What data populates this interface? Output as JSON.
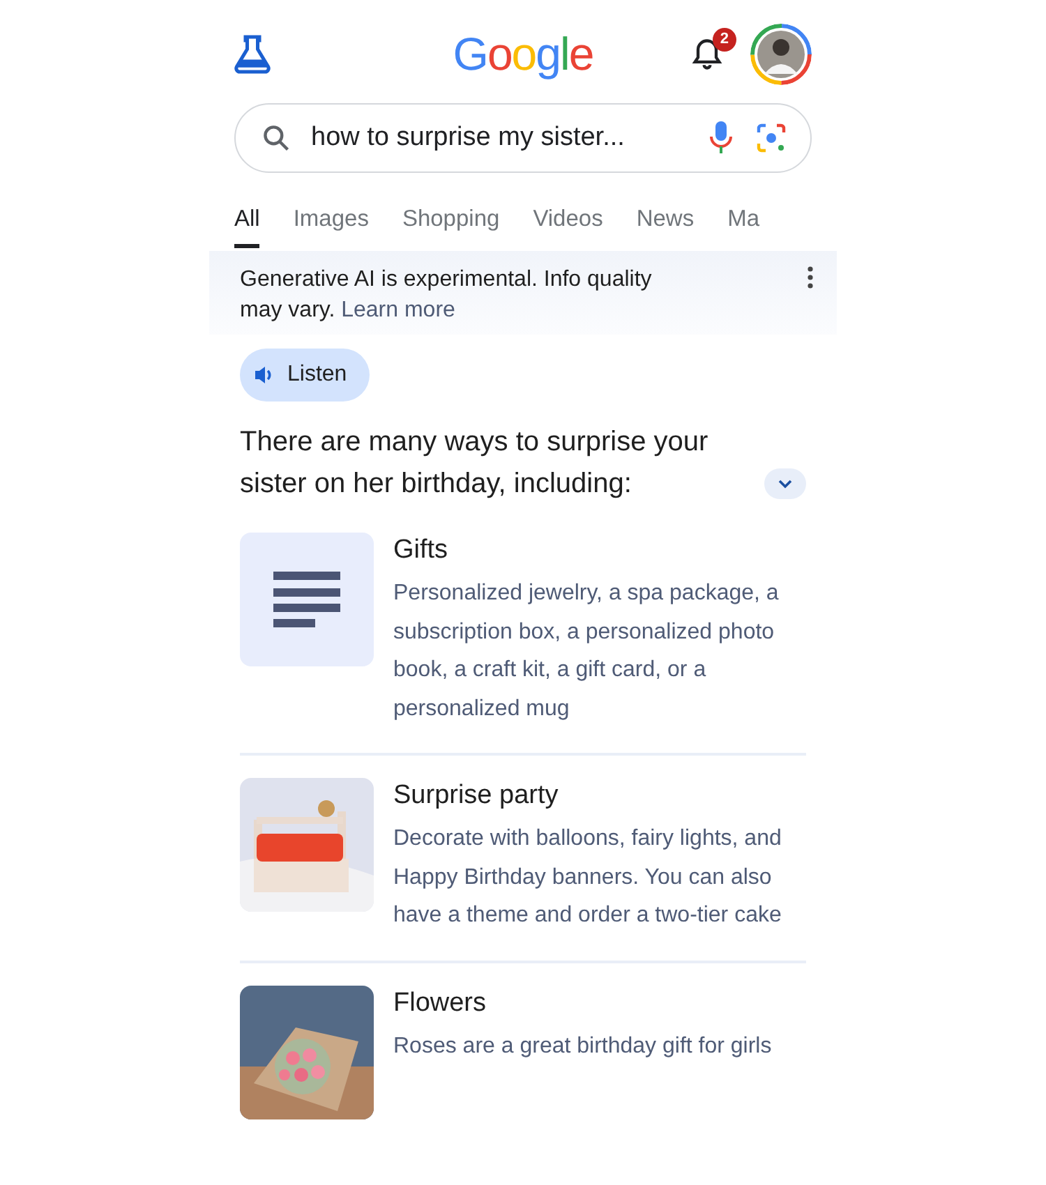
{
  "header": {
    "logo": "Google",
    "notifications": {
      "count": "2"
    }
  },
  "search": {
    "value": "how to surprise my sister..."
  },
  "tabs": [
    {
      "label": "All",
      "selected": true
    },
    {
      "label": "Images",
      "selected": false
    },
    {
      "label": "Shopping",
      "selected": false
    },
    {
      "label": "Videos",
      "selected": false
    },
    {
      "label": "News",
      "selected": false
    },
    {
      "label": "Ma",
      "selected": false
    }
  ],
  "notice": {
    "text": "Generative AI is experimental. Info quality may vary.",
    "link": "Learn more"
  },
  "listen_button": "Listen",
  "summary": "There are many ways to surprise your sister on her birthday, including:",
  "items": [
    {
      "kind": "icon",
      "title": "Gifts",
      "text": "Personalized jewelry, a spa package, a subscription box, a personalized photo book, a craft kit, a gift card, or a personalized mug"
    },
    {
      "kind": "picture",
      "title": "Surprise party",
      "text": "Decorate with balloons, fairy lights, and Happy Birthday banners. You can also have a theme and order a two-tier cake"
    },
    {
      "kind": "picture",
      "title": "Flowers",
      "text": "Roses are a great birthday gift for girls"
    }
  ]
}
